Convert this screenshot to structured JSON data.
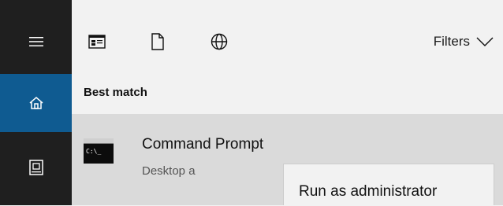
{
  "nav": {
    "items": [
      {
        "id": "menu",
        "icon": "hamburger-icon"
      },
      {
        "id": "home",
        "icon": "home-icon",
        "selected": true
      },
      {
        "id": "documents",
        "icon": "document-icon"
      }
    ],
    "accent": "#0f5b91"
  },
  "toolbar": {
    "icons": [
      "apps-icon",
      "documents-icon",
      "web-icon"
    ],
    "filters_label": "Filters"
  },
  "results": {
    "section_label": "Best match",
    "items": [
      {
        "title": "Command Prompt",
        "subtitle": "Desktop a",
        "icon_text": "C:\\_"
      }
    ]
  },
  "context_menu": {
    "items": [
      "Run as administrator"
    ]
  }
}
